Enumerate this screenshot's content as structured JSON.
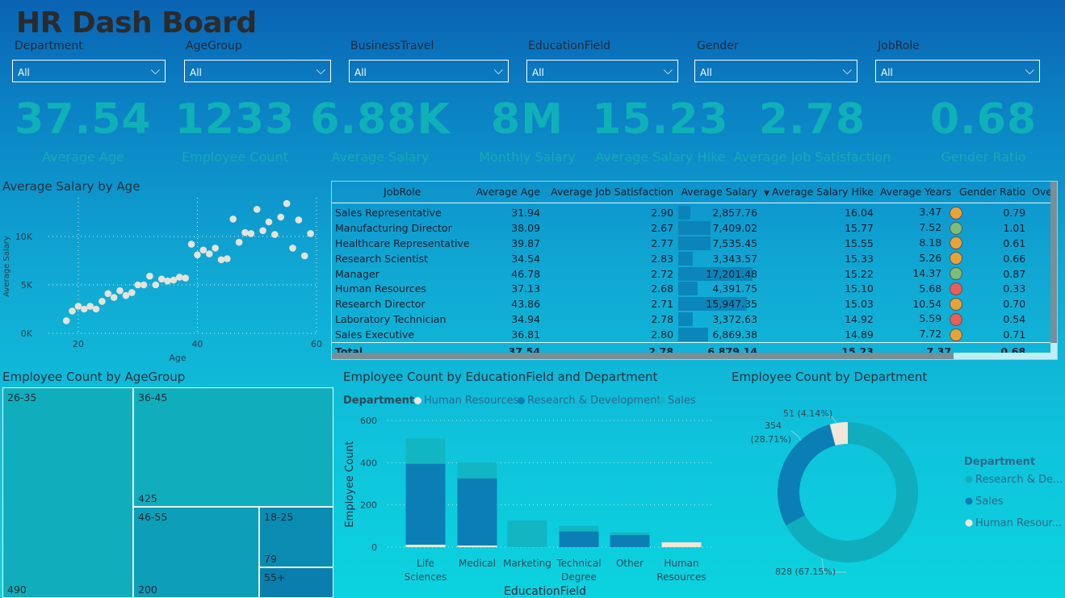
{
  "title": "HR Dash Board",
  "slicers": [
    {
      "label": "Department",
      "value": "All"
    },
    {
      "label": "AgeGroup",
      "value": "All"
    },
    {
      "label": "BusinessTravel",
      "value": "All"
    },
    {
      "label": "EducationField",
      "value": "All"
    },
    {
      "label": "Gender",
      "value": "All"
    },
    {
      "label": "JobRole",
      "value": "All"
    }
  ],
  "kpis": [
    {
      "value": "37.54",
      "label": "Average Age"
    },
    {
      "value": "1233",
      "label": "Employee Count"
    },
    {
      "value": "6.88K",
      "label": "Average Salary"
    },
    {
      "value": "8M",
      "label": "Monthly Salary"
    },
    {
      "value": "15.23",
      "label": "Average Salary Hike"
    },
    {
      "value": "2.78",
      "label": "Average Job Satisfaction"
    },
    {
      "value": "0.68",
      "label": "Gender Ratio"
    }
  ],
  "scatter": {
    "title": "Average Salary by Age",
    "xlabel": "Age",
    "ylabel": "Average Salary",
    "xticks": [
      "20",
      "40",
      "60"
    ],
    "yticks": [
      "0K",
      "5K",
      "10K"
    ]
  },
  "table": {
    "headers": [
      "JobRole",
      "Average Age",
      "Average Job Satisfaction",
      "Average Salary",
      "Average Salary Hike",
      "Average Years",
      "Gender Ratio",
      "OverTime"
    ],
    "rows": [
      {
        "role": "Sales Representative",
        "age": "31.94",
        "sat": "2.90",
        "salary": "2,857.76",
        "hike": "16.04",
        "years": "3.47",
        "ratio": "0.79",
        "color": "#e5a43a"
      },
      {
        "role": "Manufacturing Director",
        "age": "38.09",
        "sat": "2.67",
        "salary": "7,409.02",
        "hike": "15.77",
        "years": "7.52",
        "ratio": "1.01",
        "color": "#7dbd7a"
      },
      {
        "role": "Healthcare Representative",
        "age": "39.87",
        "sat": "2.77",
        "salary": "7,535.45",
        "hike": "15.55",
        "years": "8.18",
        "ratio": "0.61",
        "color": "#e5a43a"
      },
      {
        "role": "Research Scientist",
        "age": "34.54",
        "sat": "2.83",
        "salary": "3,343.57",
        "hike": "15.33",
        "years": "5.26",
        "ratio": "0.66",
        "color": "#e5a43a"
      },
      {
        "role": "Manager",
        "age": "46.78",
        "sat": "2.72",
        "salary": "17,201.48",
        "hike": "15.22",
        "years": "14.37",
        "ratio": "0.87",
        "color": "#7dbd7a"
      },
      {
        "role": "Human Resources",
        "age": "37.13",
        "sat": "2.68",
        "salary": "4,391.75",
        "hike": "15.10",
        "years": "5.68",
        "ratio": "0.33",
        "color": "#e8605a"
      },
      {
        "role": "Research Director",
        "age": "43.86",
        "sat": "2.71",
        "salary": "15,947.35",
        "hike": "15.03",
        "years": "10.54",
        "ratio": "0.70",
        "color": "#e5a43a"
      },
      {
        "role": "Laboratory Technician",
        "age": "34.94",
        "sat": "2.78",
        "salary": "3,372.63",
        "hike": "14.92",
        "years": "5.59",
        "ratio": "0.54",
        "color": "#e8605a"
      },
      {
        "role": "Sales Executive",
        "age": "36.81",
        "sat": "2.80",
        "salary": "6,869.38",
        "hike": "14.89",
        "years": "7.72",
        "ratio": "0.71",
        "color": "#e5a43a"
      }
    ],
    "total": {
      "role": "Total",
      "age": "37.54",
      "sat": "2.78",
      "salary": "6,879.14",
      "hike": "15.23",
      "years": "7.37",
      "ratio": "0.68"
    }
  },
  "treemap": {
    "title": "Employee Count by AgeGroup",
    "cells": [
      {
        "label": "26-35",
        "value": "490"
      },
      {
        "label": "36-45",
        "value": "425"
      },
      {
        "label": "46-55",
        "value": "200"
      },
      {
        "label": "18-25",
        "value": "79"
      },
      {
        "label": "55+",
        "value": ""
      }
    ]
  },
  "stacked": {
    "title": "Employee Count by EducationField and Department",
    "legend_title": "Department",
    "legend": [
      "Human Resources",
      "Research & Development",
      "Sales"
    ],
    "ylabel": "Employee Count",
    "xlabel": "EducationField",
    "yticks": [
      "0",
      "200",
      "400",
      "600"
    ],
    "categories": [
      {
        "l1": "Life",
        "l2": "Sciences"
      },
      {
        "l1": "Medical",
        "l2": ""
      },
      {
        "l1": "Marketing",
        "l2": ""
      },
      {
        "l1": "Technical",
        "l2": "Degree"
      },
      {
        "l1": "Other",
        "l2": ""
      },
      {
        "l1": "Human",
        "l2": "Resources"
      }
    ]
  },
  "donut": {
    "title": "Employee Count by Department",
    "legend_title": "Department",
    "legend": [
      "Research & De...",
      "Sales",
      "Human Resour..."
    ],
    "label_rd": "828 (67.15%)",
    "label_sales_1": "354",
    "label_sales_2": "(28.71%)",
    "label_hr": "51 (4.14%)"
  },
  "chart_data": [
    {
      "type": "scatter",
      "title": "Average Salary by Age",
      "xlabel": "Age",
      "ylabel": "Average Salary",
      "xlim": [
        15,
        60
      ],
      "ylim": [
        0,
        14000
      ],
      "points": [
        [
          18,
          1300
        ],
        [
          19,
          2300
        ],
        [
          20,
          2800
        ],
        [
          21,
          2500
        ],
        [
          22,
          2800
        ],
        [
          23,
          2500
        ],
        [
          24,
          3300
        ],
        [
          25,
          4100
        ],
        [
          26,
          3700
        ],
        [
          27,
          4400
        ],
        [
          28,
          3900
        ],
        [
          29,
          4200
        ],
        [
          30,
          5000
        ],
        [
          31,
          5000
        ],
        [
          32,
          5900
        ],
        [
          33,
          5000
        ],
        [
          34,
          5600
        ],
        [
          35,
          5400
        ],
        [
          36,
          5500
        ],
        [
          37,
          5800
        ],
        [
          38,
          5700
        ],
        [
          39,
          9200
        ],
        [
          40,
          8100
        ],
        [
          41,
          8600
        ],
        [
          42,
          8200
        ],
        [
          43,
          8800
        ],
        [
          44,
          7600
        ],
        [
          45,
          7700
        ],
        [
          46,
          11800
        ],
        [
          47,
          9400
        ],
        [
          48,
          10400
        ],
        [
          49,
          10300
        ],
        [
          50,
          12800
        ],
        [
          51,
          10600
        ],
        [
          52,
          11500
        ],
        [
          53,
          10200
        ],
        [
          54,
          12000
        ],
        [
          55,
          13400
        ],
        [
          56,
          8800
        ],
        [
          57,
          11700
        ],
        [
          58,
          8000
        ],
        [
          59,
          10300
        ]
      ]
    },
    {
      "type": "bar",
      "title": "Employee Count by EducationField and Department",
      "xlabel": "EducationField",
      "ylabel": "Employee Count",
      "ylim": [
        0,
        600
      ],
      "categories": [
        "Life Sciences",
        "Medical",
        "Marketing",
        "Technical Degree",
        "Other",
        "Human Resources"
      ],
      "series": [
        {
          "name": "Human Resources",
          "values": [
            12,
            8,
            0,
            0,
            0,
            23
          ]
        },
        {
          "name": "Research & Development",
          "values": [
            383,
            318,
            0,
            75,
            58,
            0
          ]
        },
        {
          "name": "Sales",
          "values": [
            120,
            75,
            127,
            25,
            12,
            0
          ]
        }
      ]
    },
    {
      "type": "pie",
      "title": "Employee Count by Department",
      "categories": [
        "Research & Development",
        "Sales",
        "Human Resources"
      ],
      "values": [
        828,
        354,
        51
      ]
    }
  ]
}
